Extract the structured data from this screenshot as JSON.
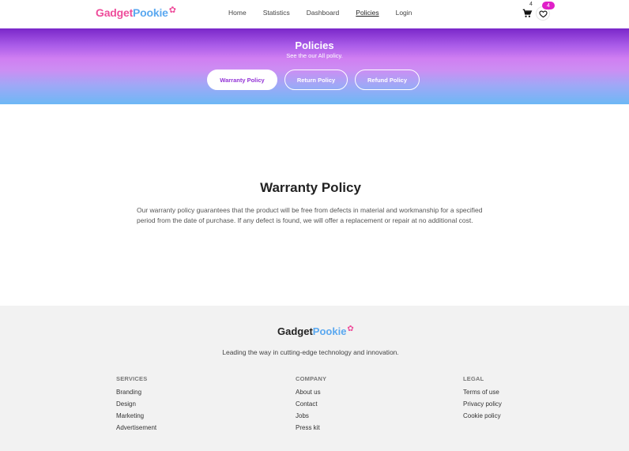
{
  "brand": {
    "gadget": "Gadget",
    "pookie": "Pookie",
    "bow": "🎀"
  },
  "nav": {
    "links": [
      {
        "label": "Home",
        "active": false
      },
      {
        "label": "Statistics",
        "active": false
      },
      {
        "label": "Dashboard",
        "active": false
      },
      {
        "label": "Policies",
        "active": true
      },
      {
        "label": "Login",
        "active": false
      }
    ],
    "cart_count": "4",
    "wishlist_count": "4"
  },
  "hero": {
    "title": "Policies",
    "subtitle": "See the our All policy.",
    "tabs": [
      "Warranty Policy",
      "Return Policy",
      "Refund Policy"
    ],
    "active_tab": "Warranty Policy"
  },
  "content": {
    "title": "Warranty Policy",
    "body": "Our warranty policy guarantees that the product will be free from defects in material and workmanship for a specified period from the date of purchase. If any defect is found, we will offer a replacement or repair at no additional cost."
  },
  "footer": {
    "tagline": "Leading the way in cutting-edge technology and innovation.",
    "services": {
      "heading": "SERVICES",
      "items": [
        "Branding",
        "Design",
        "Marketing",
        "Advertisement"
      ]
    },
    "company": {
      "heading": "COMPANY",
      "items": [
        "About us",
        "Contact",
        "Jobs",
        "Press kit"
      ]
    },
    "legal": {
      "heading": "LEGAL",
      "items": [
        "Terms of use",
        "Privacy policy",
        "Cookie policy"
      ]
    }
  },
  "colors": {
    "accent": "#9333d6",
    "badge": "#e020c8",
    "brand_pink": "#ee4d9b",
    "brand_blue": "#5aa8f0"
  }
}
